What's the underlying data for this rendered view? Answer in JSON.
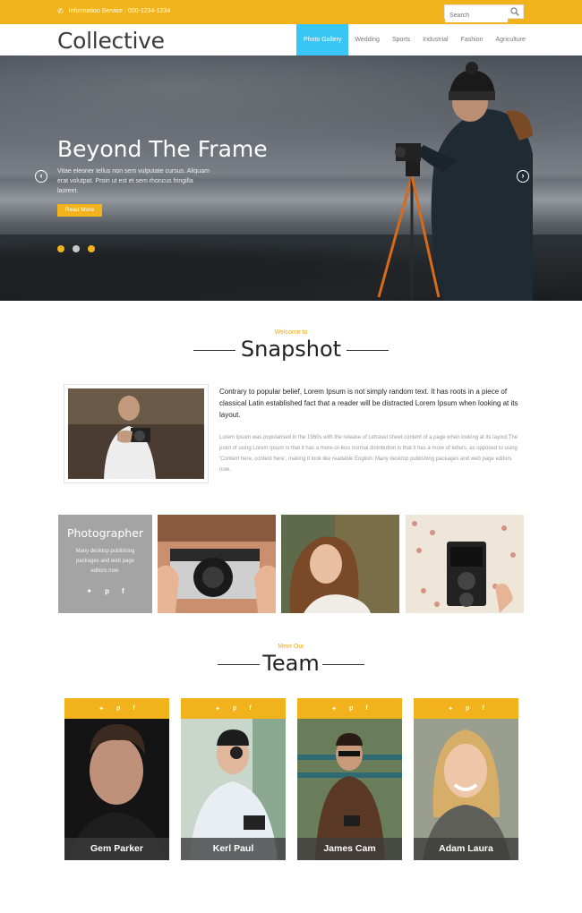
{
  "topbar": {
    "info_label": "Information Service : 000-1234-1234",
    "search_placeholder": "Search"
  },
  "header": {
    "logo": "Collective",
    "nav": [
      "Photo Gallery",
      "Wedding",
      "Sports",
      "Industrial",
      "Fashion",
      "Agriculture"
    ],
    "active_nav": "Photo Gallery"
  },
  "hero": {
    "title": "Beyond The Frame",
    "text": "Vitae eleoner tellus non sem vulputate cursus. Aliquam erat volutpat. Proin ut est et sem rhoncus fringilla laoreet.",
    "button": "Read More",
    "dots": [
      "active",
      "inactive",
      "active"
    ]
  },
  "snapshot": {
    "kicker": "Welcome to",
    "title": "Snapshot",
    "lead": "Contrary to popular belief, Lorem Ipsum is not simply random text. It has roots in a piece of classical Latin established fact that a reader will be distracted Lorem Ipsum when looking at its layout.",
    "body": "Lorem Ipsum was popularised in the 1960s with the release of Letraset sheet content of a page when looking at its layout.The point of using Lorem Ipsum is that it has a more-or-less normal distribution is that it has a more of letters, as opposed to using 'Content here, content here', making it look like readable English. Many desktop publishing packages and web page editors now."
  },
  "gallery": {
    "title": "Photographer",
    "text": "Many desktop publishing packages and web page editors now.",
    "social": [
      "twitter",
      "pinterest",
      "facebook"
    ]
  },
  "team": {
    "kicker": "Meet Our",
    "title": "Team",
    "members": [
      {
        "name": "Gem Parker"
      },
      {
        "name": "Kerl Paul"
      },
      {
        "name": "James Cam"
      },
      {
        "name": "Adam Laura"
      }
    ]
  },
  "colors": {
    "accent": "#f2b21b",
    "nav_active": "#38c6f4",
    "card_grey": "#a4a4a4"
  }
}
